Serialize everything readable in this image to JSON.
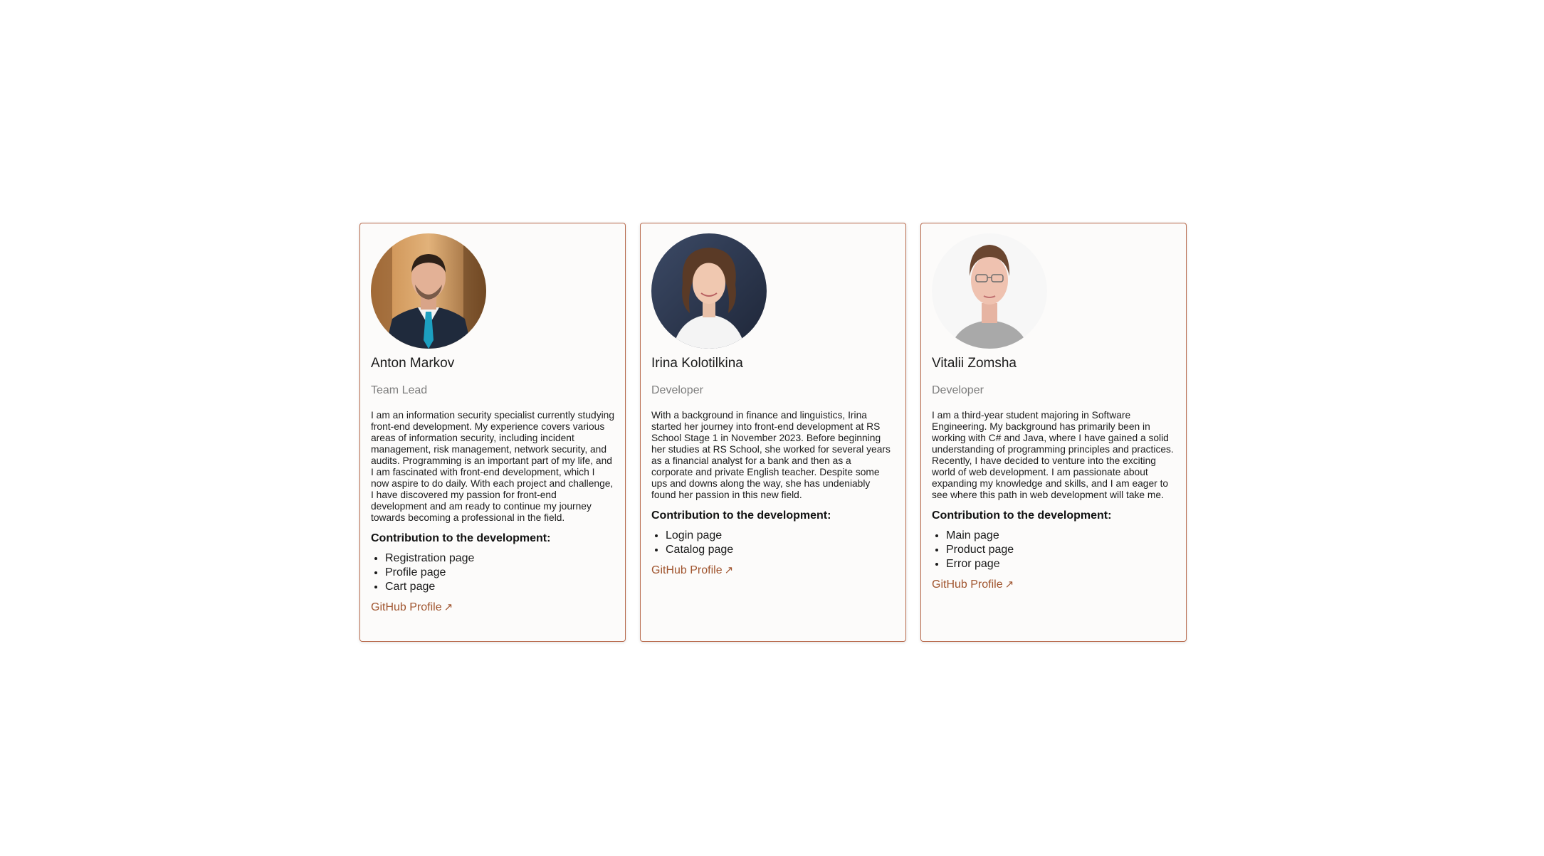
{
  "colors": {
    "card_border": "#b86a4c",
    "card_background": "#fcfbfa",
    "link": "#a0552f",
    "role_text": "#7d7d7d"
  },
  "members": [
    {
      "name": "Anton Markov",
      "role": "Team Lead",
      "bio": "I am an information security specialist currently studying front-end development. My experience covers various areas of information security, including incident management, risk management, network security, and audits. Programming is an important part of my life, and I am fascinated with front-end development, which I now aspire to do daily. With each project and challenge, I have discovered my passion for front-end development and am ready to continue my journey towards becoming a professional in the field.",
      "contribution_title": "Contribution to the development:",
      "contributions": [
        "Registration page",
        "Profile page",
        "Cart page"
      ],
      "github_label": "GitHub Profile",
      "github_icon": "↗"
    },
    {
      "name": "Irina Kolotilkina",
      "role": "Developer",
      "bio": "With a background in finance and linguistics, Irina started her journey into front-end development at RS School Stage 1 in November 2023. Before beginning her studies at RS School, she worked for several years as a financial analyst for a bank and then as a corporate and private English teacher. Despite some ups and downs along the way, she has undeniably found her passion in this new field.",
      "contribution_title": "Contribution to the development:",
      "contributions": [
        "Login page",
        "Catalog page"
      ],
      "github_label": "GitHub Profile",
      "github_icon": "↗"
    },
    {
      "name": "Vitalii Zomsha",
      "role": "Developer",
      "bio": "I am a third-year student majoring in Software Engineering. My background has primarily been in working with C# and Java, where I have gained a solid understanding of programming principles and practices. Recently, I have decided to venture into the exciting world of web development. I am passionate about expanding my knowledge and skills, and I am eager to see where this path in web development will take me.",
      "contribution_title": "Contribution to the development:",
      "contributions": [
        "Main page",
        "Product page",
        "Error page"
      ],
      "github_label": "GitHub Profile",
      "github_icon": "↗"
    }
  ]
}
